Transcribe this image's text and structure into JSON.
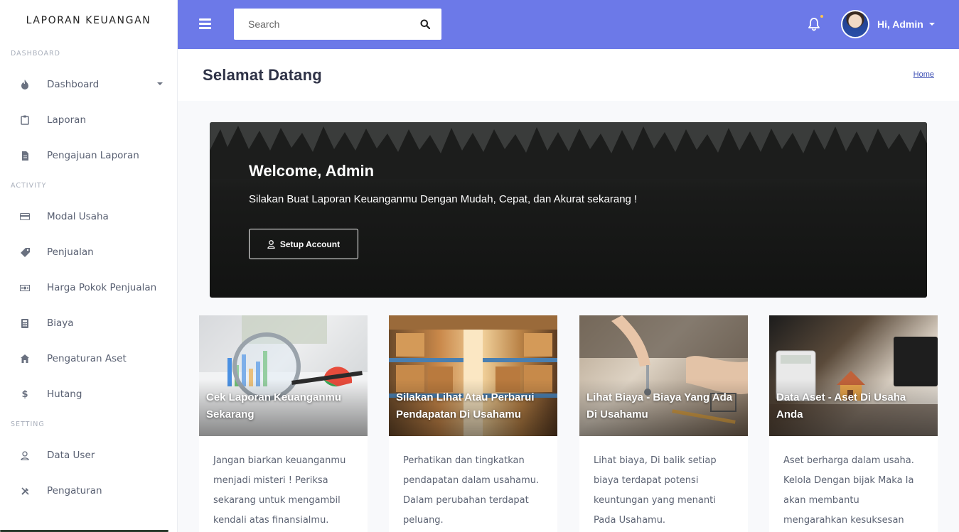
{
  "sidebar": {
    "brand": "LAPORAN KEUANGAN",
    "sections": [
      {
        "title": "DASHBOARD",
        "items": [
          {
            "label": "Dashboard",
            "icon": "fire-icon"
          },
          {
            "label": "Laporan",
            "icon": "clipboard-icon"
          },
          {
            "label": "Pengajuan Laporan",
            "icon": "document-icon"
          }
        ]
      },
      {
        "title": "ACTIVITY",
        "items": [
          {
            "label": "Modal Usaha",
            "icon": "credit-card-icon"
          },
          {
            "label": "Penjualan",
            "icon": "tag-icon"
          },
          {
            "label": "Harga Pokok Penjualan",
            "icon": "money-icon"
          },
          {
            "label": "Biaya",
            "icon": "calculator-icon"
          },
          {
            "label": "Pengaturan Aset",
            "icon": "home-icon"
          },
          {
            "label": "Hutang",
            "icon": "dollar-icon"
          }
        ]
      },
      {
        "title": "SETTING",
        "items": [
          {
            "label": "Data User",
            "icon": "user-icon"
          },
          {
            "label": "Pengaturan",
            "icon": "tools-icon"
          }
        ]
      }
    ]
  },
  "topbar": {
    "search_placeholder": "Search",
    "user_greeting": "Hi, Admin",
    "accent_color": "#6c79e8"
  },
  "page": {
    "title": "Selamat Datang",
    "breadcrumb": "Home"
  },
  "banner": {
    "title": "Welcome, Admin",
    "subtitle": "Silakan Buat Laporan Keuanganmu Dengan Mudah, Cepat, dan Akurat sekarang !",
    "button_label": "Setup Account"
  },
  "cards": [
    {
      "title": "Cek Laporan Keuanganmu Sekarang",
      "text": "Jangan biarkan keuanganmu menjadi misteri ! Periksa sekarang untuk mengambil kendali atas finansialmu."
    },
    {
      "title": "Silakan Lihat Atau Perbarui Pendapatan Di Usahamu",
      "text": "Perhatikan dan tingkatkan pendapatan dalam usahamu. Dalam perubahan terdapat peluang."
    },
    {
      "title": "Lihat Biaya - Biaya Yang Ada Di Usahamu",
      "text": "Lihat biaya, Di balik setiap biaya terdapat potensi keuntungan yang menanti Pada Usahamu."
    },
    {
      "title": "Data Aset - Aset Di Usaha Anda",
      "text": "Aset berharga dalam usaha. Kelola Dengan bijak Maka Ia akan membantu mengarahkan kesuksesan Anda."
    }
  ]
}
